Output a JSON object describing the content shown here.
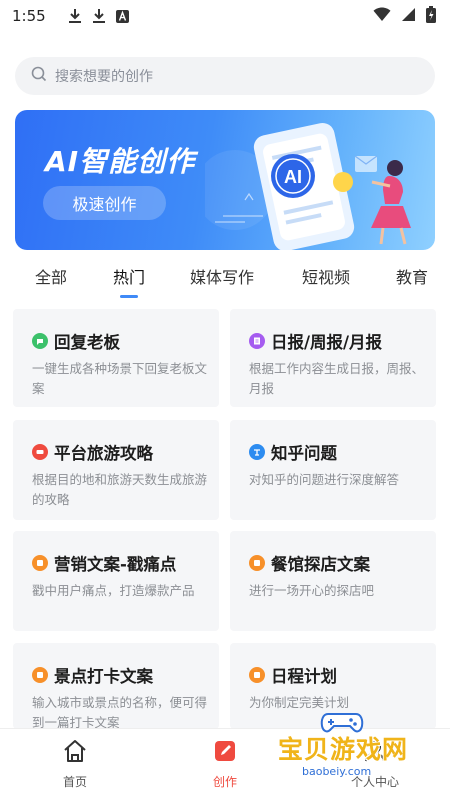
{
  "status_bar": {
    "time": "1:55",
    "notification_icons": [
      "download-icon",
      "download-icon",
      "a-icon"
    ],
    "right_icons": [
      "wifi-icon",
      "signal-icon",
      "battery-icon"
    ]
  },
  "search": {
    "placeholder": "搜索想要的创作"
  },
  "banner": {
    "title": "AI智能创作",
    "button": "极速创作",
    "art_badge": "AI"
  },
  "tabs": [
    {
      "label": "全部"
    },
    {
      "label": "热门",
      "active": true
    },
    {
      "label": "媒体写作"
    },
    {
      "label": "短视频"
    },
    {
      "label": "教育"
    }
  ],
  "cards": [
    {
      "title": "回复老板",
      "desc": "一键生成各种场景下回复老板文案",
      "icon": "reply-icon",
      "icon_color": "#3cc16b"
    },
    {
      "title": "日报/周报/月报",
      "desc": "根据工作内容生成日报，周报、月报",
      "icon": "report-icon",
      "icon_color": "#a55cf0"
    },
    {
      "title": "平台旅游攻略",
      "desc": "根据目的地和旅游天数生成旅游的攻略",
      "icon": "travel-icon",
      "icon_color": "#ef4b3f"
    },
    {
      "title": "知乎问题",
      "desc": "对知乎的问题进行深度解答",
      "icon": "zhihu-icon",
      "icon_color": "#2d8cf0"
    },
    {
      "title": "营销文案-戳痛点",
      "desc": "戳中用户痛点，打造爆款产品",
      "icon": "marketing-icon",
      "icon_color": "#f7902a"
    },
    {
      "title": "餐馆探店文案",
      "desc": "进行一场开心的探店吧",
      "icon": "restaurant-icon",
      "icon_color": "#f7902a"
    },
    {
      "title": "景点打卡文案",
      "desc": "输入城市或景点的名称，便可得到一篇打卡文案",
      "icon": "scenic-icon",
      "icon_color": "#f7902a"
    },
    {
      "title": "日程计划",
      "desc": "为你制定完美计划",
      "icon": "schedule-icon",
      "icon_color": "#f7902a"
    }
  ],
  "bottom_nav": [
    {
      "label": "首页",
      "icon": "home-icon"
    },
    {
      "label": "创作",
      "icon": "create-icon",
      "active": true
    },
    {
      "label": "个人中心",
      "icon": "profile-icon"
    }
  ],
  "watermark": {
    "text": "宝贝游戏网",
    "url": "baobeiy.com"
  }
}
